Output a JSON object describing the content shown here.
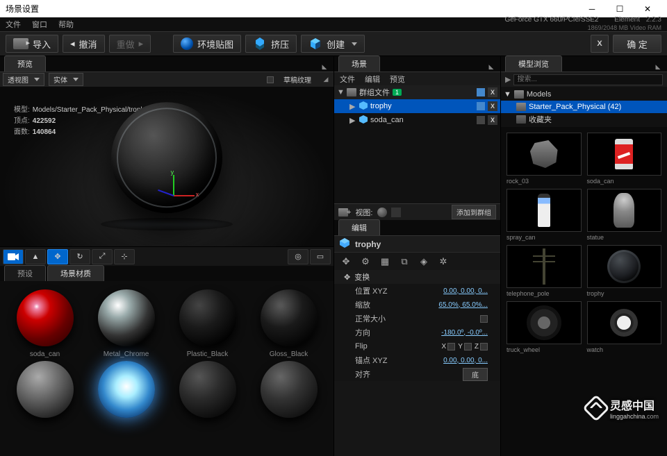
{
  "titlebar": {
    "title": "场景设置"
  },
  "menubar": {
    "file": "文件",
    "window": "窗口",
    "help": "帮助",
    "gpu": "GeForce GTX 660/PCIe/SSE2",
    "vram": "1869/2048 MB Video RAM",
    "app": "Element",
    "ver": "2.2.3"
  },
  "toolbar": {
    "import": "导入",
    "undo": "撤消",
    "redo": "重做",
    "env": "环境贴图",
    "extrude": "挤压",
    "create": "创建",
    "ok": "确 定"
  },
  "preview": {
    "tab": "预览",
    "view_mode": "透视图",
    "shade_mode": "实体",
    "draft": "草稿纹理",
    "model_label": "模型:",
    "model_path": "Models/Starter_Pack_Physical/trophy.obj",
    "verts_label": "顶点:",
    "verts": "422592",
    "faces_label": "面数:",
    "faces": "140864"
  },
  "materials": {
    "tab_presets": "预设",
    "tab_scene": "场景材质",
    "items": [
      "soda_can",
      "Metal_Chrome",
      "Plastic_Black",
      "Gloss_Black"
    ]
  },
  "scene": {
    "tab": "场景",
    "sub_file": "文件",
    "sub_edit": "编辑",
    "sub_preview": "预览",
    "group": "群组文件",
    "group_badge": "1",
    "items": [
      "trophy",
      "soda_can"
    ],
    "view_label": "视图:",
    "add_to_group": "添加到群组"
  },
  "edit": {
    "tab": "编辑",
    "obj_name": "trophy",
    "section": "变换",
    "pos_label": "位置 XYZ",
    "pos_val": "0.00, 0.00, 0...",
    "scale_label": "缩放",
    "scale_val": "65.0%, 65.0%...",
    "normal_label": "正常大小",
    "orient_label": "方向",
    "orient_val": "-180.0º, -0.0º...",
    "flip_label": "Flip",
    "anchor_label": "锚点 XYZ",
    "anchor_val": "0.00, 0.00, 0...",
    "align_label": "对齐",
    "align_btn": "底"
  },
  "browser": {
    "tab": "模型浏览",
    "search": "搜索...",
    "root": "Models",
    "folder": "Starter_Pack_Physical (42)",
    "fav": "收藏夹",
    "thumbs": [
      "rock_03",
      "soda_can",
      "spray_can",
      "statue",
      "telephone_pole",
      "trophy",
      "truck_wheel",
      "watch"
    ]
  },
  "watermark": {
    "cn": "灵感中国",
    "en": "linggahchina",
    "tld": ".com"
  }
}
